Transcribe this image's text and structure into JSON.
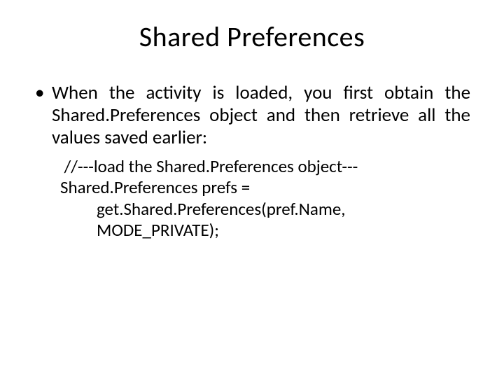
{
  "title": "Shared Preferences",
  "bullet_text": "When the activity is loaded, you first obtain the Shared.Preferences object and then retrieve all the values saved earlier:",
  "code": {
    "line1": " //---load the Shared.Preferences object---",
    "line2": "Shared.Preferences prefs =",
    "line3": "get.Shared.Preferences(pref.Name,",
    "line4": "MODE_PRIVATE);"
  }
}
